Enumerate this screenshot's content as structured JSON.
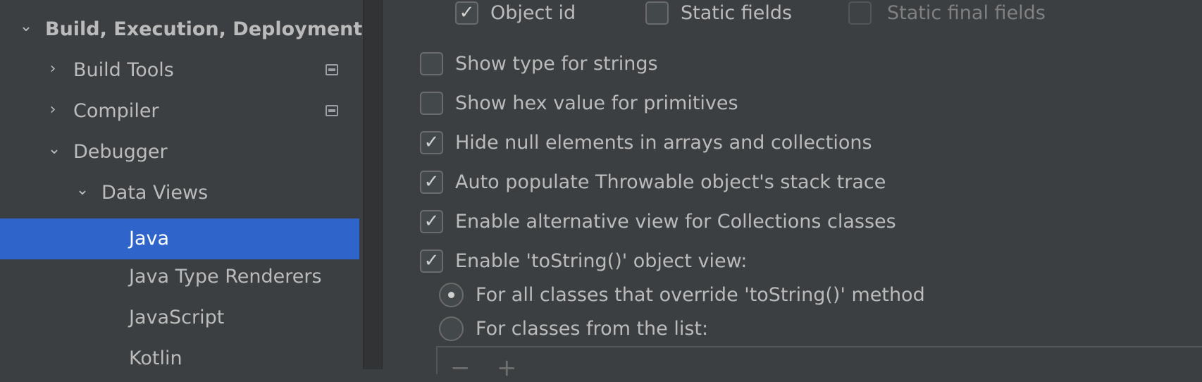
{
  "sidebar": {
    "items": [
      {
        "label": "Build, Execution, Deployment",
        "arrow": "⌄",
        "arrow_icon": "chevron-down-icon",
        "bold": true
      },
      {
        "label": "Build Tools",
        "arrow": "›",
        "arrow_icon": "chevron-right-icon",
        "bold": false,
        "project_icon": true
      },
      {
        "label": "Compiler",
        "arrow": "›",
        "arrow_icon": "chevron-right-icon",
        "bold": false,
        "project_icon": true
      },
      {
        "label": "Debugger",
        "arrow": "⌄",
        "arrow_icon": "chevron-down-icon",
        "bold": false
      },
      {
        "label": "Data Views",
        "arrow": "⌄",
        "arrow_icon": "chevron-down-icon",
        "bold": false
      },
      {
        "label": "Java",
        "selected": true
      },
      {
        "label": "Java Type Renderers"
      },
      {
        "label": "JavaScript"
      },
      {
        "label": "Kotlin"
      }
    ]
  },
  "settings": {
    "top_row": [
      {
        "label": "Object id",
        "checked": true,
        "disabled": false
      },
      {
        "label": "Static fields",
        "checked": false,
        "disabled": false
      },
      {
        "label": "Static final fields",
        "checked": false,
        "disabled": true
      }
    ],
    "options": [
      {
        "label": "Show type for strings",
        "checked": false
      },
      {
        "label": "Show hex value for primitives",
        "checked": false
      },
      {
        "label": "Hide null elements in arrays and collections",
        "checked": true
      },
      {
        "label": "Auto populate Throwable object's stack trace",
        "checked": true
      },
      {
        "label": "Enable alternative view for Collections classes",
        "checked": true
      },
      {
        "label": "Enable 'toString()' object view:",
        "checked": true
      }
    ],
    "radios": [
      {
        "label": "For all classes that override 'toString()' method",
        "selected": true
      },
      {
        "label": "For classes from the list:",
        "selected": false
      }
    ],
    "list_tools": {
      "remove": "−",
      "add": "+"
    }
  },
  "colors": {
    "selection": "#2f65ca",
    "background": "#3c3f41",
    "text": "#bbbbbb"
  }
}
